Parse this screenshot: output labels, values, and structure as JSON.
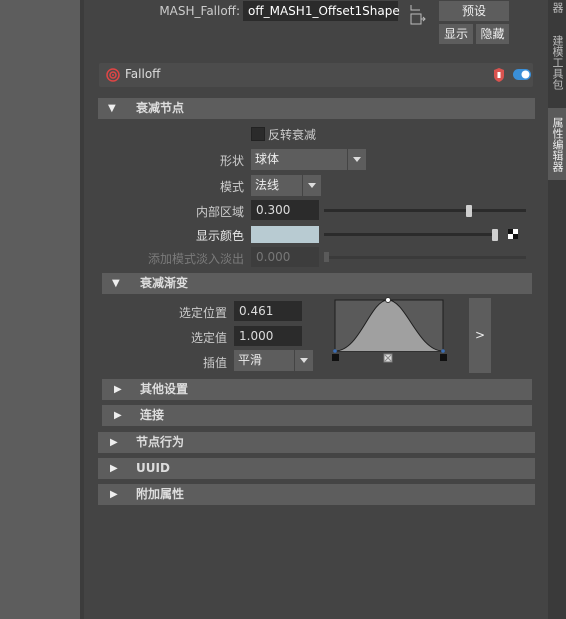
{
  "header": {
    "mash_falloff_label": "MASH_Falloff:",
    "mash_falloff_value": "off_MASH1_Offset1Shape",
    "preset_button": "预设",
    "show_button": "显示",
    "hide_button": "隐藏"
  },
  "node_header": {
    "title": "Falloff"
  },
  "falloff_node_section": {
    "title": "衰减节点",
    "invert_falloff_label": "反转衰减",
    "invert_falloff_checked": false,
    "shape_label": "形状",
    "shape_value": "球体",
    "mode_label": "模式",
    "mode_value": "法线",
    "inner_area_label": "内部区域",
    "inner_area_value": "0.300",
    "inner_area_fraction": 0.3,
    "display_color_label": "显示颜色",
    "display_color": "#b8cbd2",
    "display_color_level": 1.0,
    "additive_fade_label": "添加模式淡入淡出",
    "additive_fade_value": "0.000"
  },
  "falloff_ramp_section": {
    "title": "衰减渐变",
    "selected_position_label": "选定位置",
    "selected_position_value": "0.461",
    "selected_value_label": "选定值",
    "selected_value_value": "1.000",
    "interpolation_label": "插值",
    "interpolation_value": "平滑",
    "expand_button": ">"
  },
  "subsections": {
    "other_settings": "其他设置",
    "connections": "连接"
  },
  "sections": {
    "node_behavior": "节点行为",
    "uuid": "UUID",
    "extra_attributes": "附加属性"
  },
  "right_tabs": {
    "tab1": "器",
    "tab2": "建模工具包",
    "tab3": "属性编辑器"
  }
}
